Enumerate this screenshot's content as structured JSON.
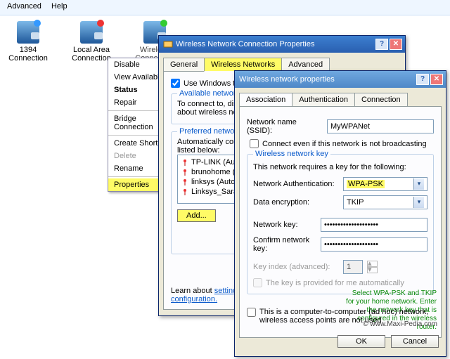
{
  "menubar": {
    "advanced": "Advanced",
    "help": "Help"
  },
  "icons": {
    "c1394": "1394 Connection",
    "lan": "Local Area Connection",
    "wlan": "Wireless Connection"
  },
  "context": {
    "disable": "Disable",
    "view": "View Available",
    "status": "Status",
    "repair": "Repair",
    "bridge": "Bridge Connection",
    "shortcut": "Create Shortcut",
    "delete": "Delete",
    "rename": "Rename",
    "properties": "Properties"
  },
  "win1": {
    "title": "Wireless Network Connection Properties",
    "tab_general": "General",
    "tab_wireless": "Wireless Networks",
    "tab_advanced": "Advanced",
    "use_windows": "Use Windows to configure my wireless network settings",
    "avail_legend": "Available networks:",
    "avail_text1": "To connect to, disconnect from, or find out more information",
    "avail_text2": "about wireless networks in range, click the button below.",
    "pref_legend": "Preferred networks:",
    "pref_text": "Automatically connect to available networks in the order listed below:",
    "nets": [
      "TP-LINK (Automatic)",
      "brunohome (Automatic)",
      "linksys (Automatic)",
      "Linksys_Sarah (Automatic)"
    ],
    "add": "Add...",
    "learn": "Learn about",
    "setting": "setting up wireless network",
    "config": "configuration."
  },
  "win2": {
    "title": "Wireless network properties",
    "tab_assoc": "Association",
    "tab_auth": "Authentication",
    "tab_conn": "Connection",
    "ssid_label": "Network name (SSID):",
    "ssid": "MyWPANet",
    "connect_even": "Connect even if this network is not broadcasting",
    "key_legend": "Wireless network key",
    "requires": "This network requires a key for the following:",
    "netauth_label": "Network Authentication:",
    "netauth": "WPA-PSK",
    "dataenc_label": "Data encryption:",
    "dataenc": "TKIP",
    "netkey_label": "Network key:",
    "confkey_label": "Confirm network key:",
    "pw": "••••••••••••••••••••",
    "keyidx_label": "Key index (advanced):",
    "keyidx": "1",
    "autokey": "The key is provided for me automatically",
    "adhoc": "This is a computer-to-computer (ad hoc) network; wireless access points are not used",
    "annot": "Select WPA-PSK and TKIP for your home network. Enter the network key that is configured in the wireless router.",
    "ok": "OK",
    "cancel": "Cancel",
    "credit": "© www.Maxi-Pedia.com"
  }
}
